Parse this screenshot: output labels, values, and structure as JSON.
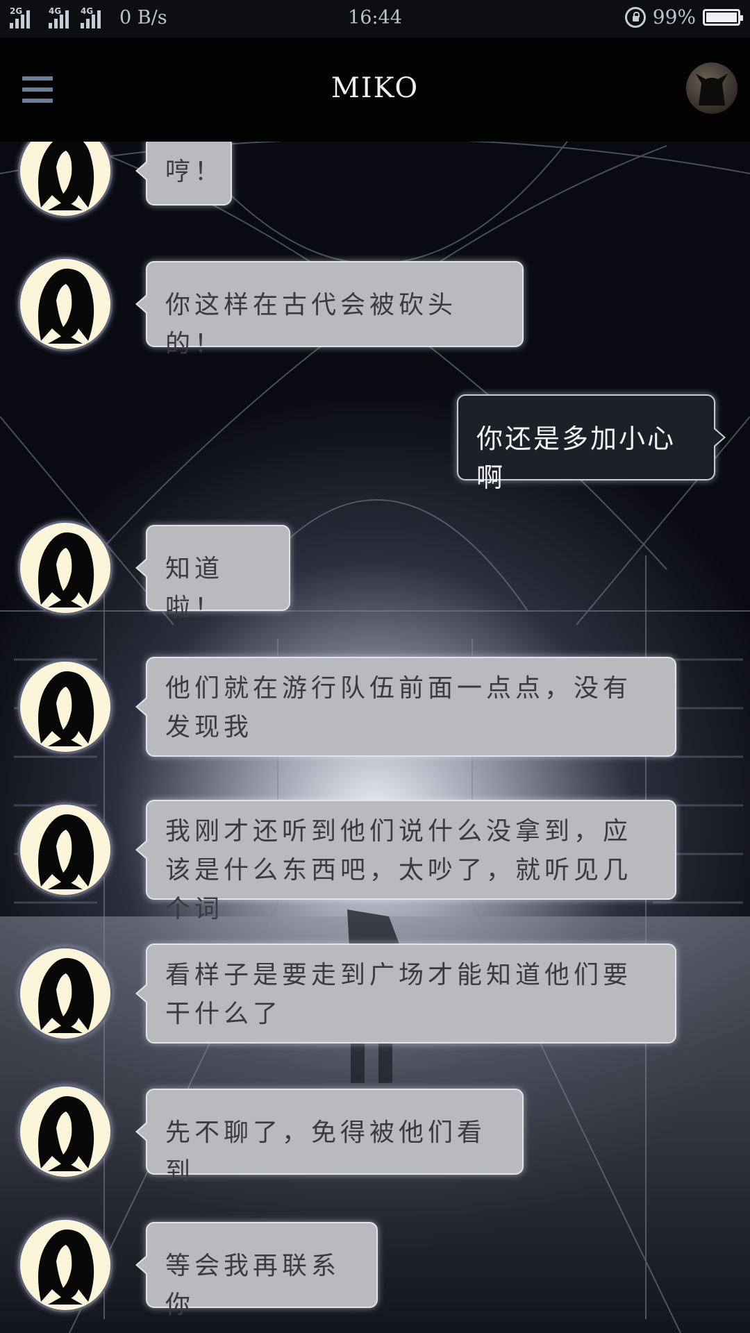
{
  "status_bar": {
    "signal1_label": "2G",
    "signal2_label": "4G",
    "signal3_label": "4G",
    "net_speed": "0 B/s",
    "time": "16:44",
    "battery_percent": "99%",
    "battery_level": 0.99
  },
  "header": {
    "title": "MIKO",
    "menu_icon": "hamburger-menu-icon",
    "avatar_icon": "cat-avatar-icon"
  },
  "colors": {
    "incoming_bubble": "#b9babd",
    "outgoing_bubble": "#1e2027",
    "avatar_bg": "#fdf5d9",
    "header_bg": "#030304",
    "menu_icon": "#6c7f9a"
  },
  "messages": [
    {
      "sender": "contact",
      "text": "哼！"
    },
    {
      "sender": "contact",
      "text": "你这样在古代会被砍头的！"
    },
    {
      "sender": "me",
      "text": "你还是多加小心啊"
    },
    {
      "sender": "contact",
      "text": "知道啦！"
    },
    {
      "sender": "contact",
      "text": "他们就在游行队伍前面一点点，没有发现我"
    },
    {
      "sender": "contact",
      "text": "我刚才还听到他们说什么没拿到，应该是什么东西吧，太吵了，就听见几个词"
    },
    {
      "sender": "contact",
      "text": "看样子是要走到广场才能知道他们要干什么了"
    },
    {
      "sender": "contact",
      "text": "先不聊了，免得被他们看到"
    },
    {
      "sender": "contact",
      "text": "等会我再联系你"
    }
  ]
}
